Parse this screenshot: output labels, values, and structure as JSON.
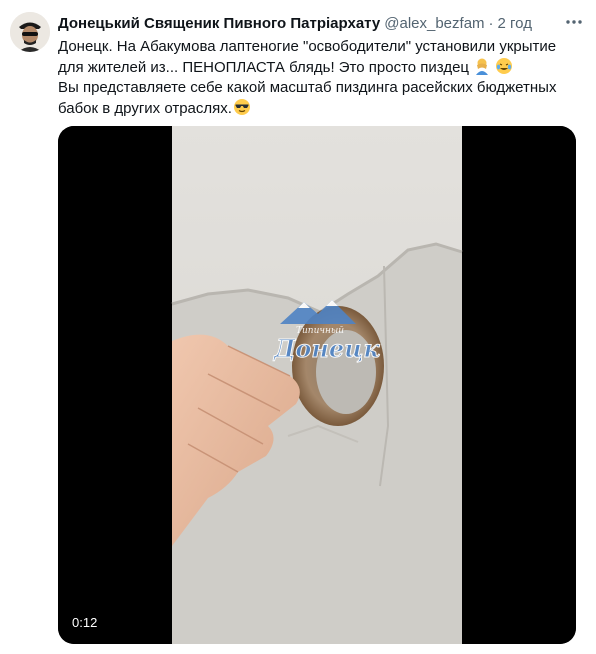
{
  "tweet": {
    "author_name": "Донецький Священик Пивного Патріархату",
    "handle": "@alex_bezfam",
    "separator": "·",
    "time": "2 год",
    "line1": "Донецк. На Абакумова лаптеногие \"освободители\" установили укрытие",
    "line2": "для жителей из... ПЕНОПЛАСТА блядь! Это просто пиздец",
    "line3": "Вы представляете себе какой масштаб пиздинга расейских бюджетных",
    "line4": "бабок в других отраслях."
  },
  "media": {
    "watermark_line1": "Типичный",
    "watermark_line2": "Донецк",
    "duration": "0:12"
  },
  "icons": {
    "more": "more-icon",
    "emoji1": "facepalm-emoji-icon",
    "emoji2": "laughing-emoji-icon",
    "emoji3": "sunglasses-emoji-icon",
    "watermark": "mountains-logo-icon"
  },
  "colors": {
    "text": "#0f1419",
    "secondary": "#536471",
    "watermark": "#4f83c4"
  }
}
